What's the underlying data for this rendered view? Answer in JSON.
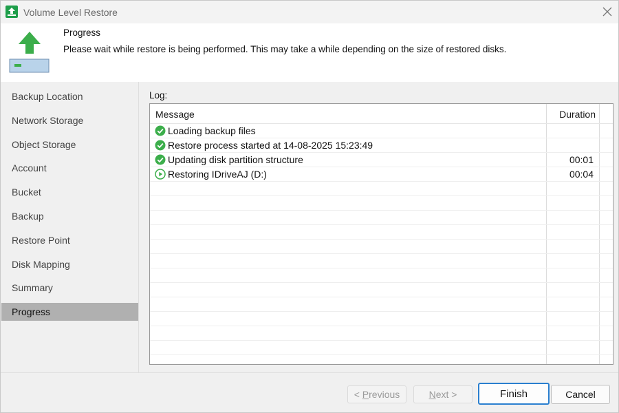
{
  "window": {
    "title": "Volume Level Restore"
  },
  "header": {
    "title": "Progress",
    "description": "Please wait while restore is being performed. This may take a while depending on the size of restored disks."
  },
  "sidebar": {
    "items": [
      {
        "label": "Backup Location",
        "active": false
      },
      {
        "label": "Network Storage",
        "active": false
      },
      {
        "label": "Object Storage",
        "active": false
      },
      {
        "label": "Account",
        "active": false
      },
      {
        "label": "Bucket",
        "active": false
      },
      {
        "label": "Backup",
        "active": false
      },
      {
        "label": "Restore Point",
        "active": false
      },
      {
        "label": "Disk Mapping",
        "active": false
      },
      {
        "label": "Summary",
        "active": false
      },
      {
        "label": "Progress",
        "active": true
      }
    ]
  },
  "log": {
    "label": "Log:",
    "columns": {
      "message": "Message",
      "duration": "Duration"
    },
    "rows": [
      {
        "status": "success-icon",
        "message": "Loading backup files",
        "duration": ""
      },
      {
        "status": "success-icon",
        "message": "Restore process started at 14-08-2025 15:23:49",
        "duration": ""
      },
      {
        "status": "success-icon",
        "message": "Updating disk partition structure",
        "duration": "00:01"
      },
      {
        "status": "running-icon",
        "message": "Restoring IDriveAJ (D:)",
        "duration": "00:04"
      }
    ]
  },
  "footer": {
    "previous": {
      "prefix": "< ",
      "mnemonic": "P",
      "rest": "revious"
    },
    "next": {
      "mnemonic": "N",
      "rest": "ext >"
    },
    "finish": "Finish",
    "cancel": "Cancel"
  },
  "colors": {
    "accent_green": "#1e9e4a",
    "success_green": "#3cae4b",
    "active_nav": "#b0b0b0",
    "primary_border": "#2a7fcf"
  }
}
